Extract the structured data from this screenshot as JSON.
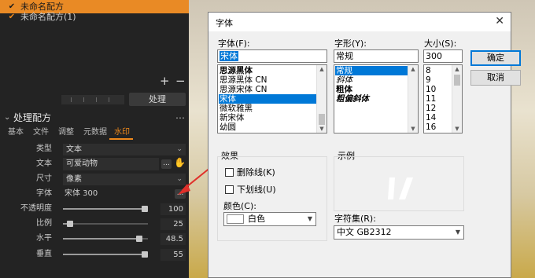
{
  "recipes": [
    {
      "label": "未命名配方",
      "selected": true
    },
    {
      "label": "未命名配方(1)",
      "selected": false
    }
  ],
  "toolbar": {
    "add": "+",
    "remove": "−",
    "process_button": "处理"
  },
  "section": {
    "title": "处理配方",
    "menu": "⋯",
    "collapse": "⌄"
  },
  "tabs": [
    {
      "label": "基本",
      "active": false
    },
    {
      "label": "文件",
      "active": false
    },
    {
      "label": "调整",
      "active": false
    },
    {
      "label": "元数据",
      "active": false
    },
    {
      "label": "水印",
      "active": true
    }
  ],
  "watermark": {
    "type_label": "类型",
    "type_value": "文本",
    "text_label": "文本",
    "text_value": "可爱动物",
    "text_dots": "...",
    "size_label": "尺寸",
    "size_value": "像素",
    "font_label": "字体",
    "font_value": "宋体 300",
    "font_dots": "...",
    "opacity_label": "不透明度",
    "opacity_value": "100",
    "opacity_level": 1.0,
    "scale_label": "比例",
    "scale_value": "25",
    "scale_level": 0.05,
    "horizontal_label": "水平",
    "horizontal_value": "48.5",
    "horizontal_level": 0.93,
    "vertical_label": "垂直",
    "vertical_value": "55",
    "vertical_level": 1.0
  },
  "dialog": {
    "title": "字体",
    "close": "✕",
    "font_label": "字体(F):",
    "font_value": "宋体",
    "font_list": [
      "思源黑体",
      "思源黑体 CN",
      "思源宋体 CN",
      "宋体",
      "微软雅黑",
      "新宋体",
      "幼圆"
    ],
    "font_selected": "宋体",
    "style_label": "字形(Y):",
    "style_value": "常规",
    "style_list": [
      "常规",
      "斜体",
      "粗体",
      "粗偏斜体"
    ],
    "style_selected": "常规",
    "size_label": "大小(S):",
    "size_value": "300",
    "size_list": [
      "8",
      "9",
      "10",
      "11",
      "12",
      "14",
      "16"
    ],
    "ok": "确定",
    "cancel": "取消",
    "effects_label": "效果",
    "strikeout": "删除线(K)",
    "underline": "下划线(U)",
    "color_label": "颜色(C):",
    "color_value": "白色",
    "color_swatch": "#ffffff",
    "sample_label": "示例",
    "charset_label": "字符集(R):",
    "charset_value": "中文 GB2312"
  },
  "colors": {
    "accent": "#e98a25",
    "highlight": "#0078d7",
    "annotation": "#e0302a"
  }
}
